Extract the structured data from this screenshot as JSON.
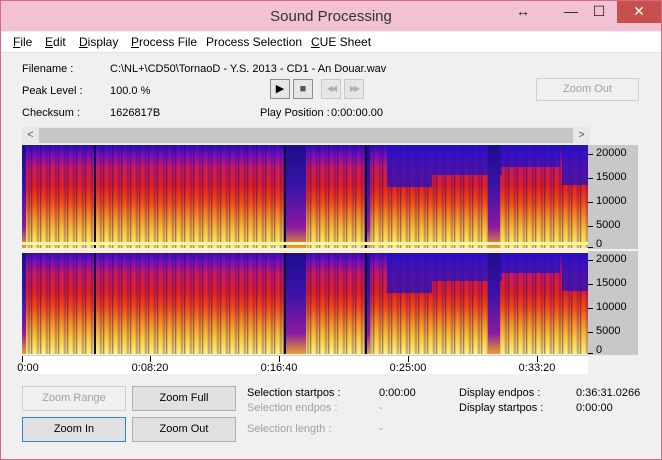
{
  "window": {
    "title": "Sound Processing",
    "restore_glyph": "↔",
    "minimize_glyph": "—",
    "maximize_glyph": "☐",
    "close_glyph": "✕"
  },
  "menu": [
    {
      "label": "File",
      "accel": "F",
      "rest": "ile"
    },
    {
      "label": "Edit",
      "accel": "E",
      "rest": "dit"
    },
    {
      "label": "Display",
      "accel": "D",
      "rest": "isplay"
    },
    {
      "label": "Process File",
      "accel": "P",
      "rest": "rocess File"
    },
    {
      "label": "Process Selection",
      "accel": "",
      "rest": "Process Selection"
    },
    {
      "label": "CUE Sheet",
      "accel": "C",
      "rest": "UE Sheet"
    }
  ],
  "info": {
    "filename_label": "Filename :",
    "filename_value": "C:\\NL+\\CD50\\TornaoD - Y.S. 2013 - CD1 - An Douar.wav",
    "peak_label": "Peak Level :",
    "peak_value": "100.0 %",
    "checksum_label": "Checksum :",
    "checksum_value": "1626817B",
    "play_position_label": "Play Position :",
    "play_position_value": "0:00:00.00"
  },
  "transport": {
    "play_icon": "▶",
    "stop_icon": "■",
    "rewind_icon": "◀◀",
    "forward_icon": "▶▶"
  },
  "zoom_out_top_label": "Zoom Out",
  "scroll": {
    "left_icon": "<",
    "right_icon": ">"
  },
  "chart_data": {
    "type": "heatmap",
    "channels": 2,
    "y_ticks": [
      "20000",
      "15000",
      "10000",
      "5000",
      "0"
    ],
    "x_ticks": [
      "0:00",
      "0:08:20",
      "0:16:40",
      "0:25:00",
      "0:33:20"
    ],
    "colors": {
      "low": "#2410c0",
      "mid": "#e02020",
      "high": "#fff27a"
    }
  },
  "buttons": {
    "zoom_range": "Zoom Range",
    "zoom_full": "Zoom Full",
    "zoom_in": "Zoom In",
    "zoom_out": "Zoom Out"
  },
  "selection": {
    "startpos_label": "Selection startpos :",
    "startpos_value": "0:00:00",
    "endpos_label": "Selection endpos :",
    "endpos_value": "-",
    "length_label": "Selection length :",
    "length_value": "-"
  },
  "display": {
    "endpos_label": "Display endpos :",
    "endpos_value": "0:36:31.0266",
    "startpos_label": "Display startpos :",
    "startpos_value": "0:00:00"
  }
}
